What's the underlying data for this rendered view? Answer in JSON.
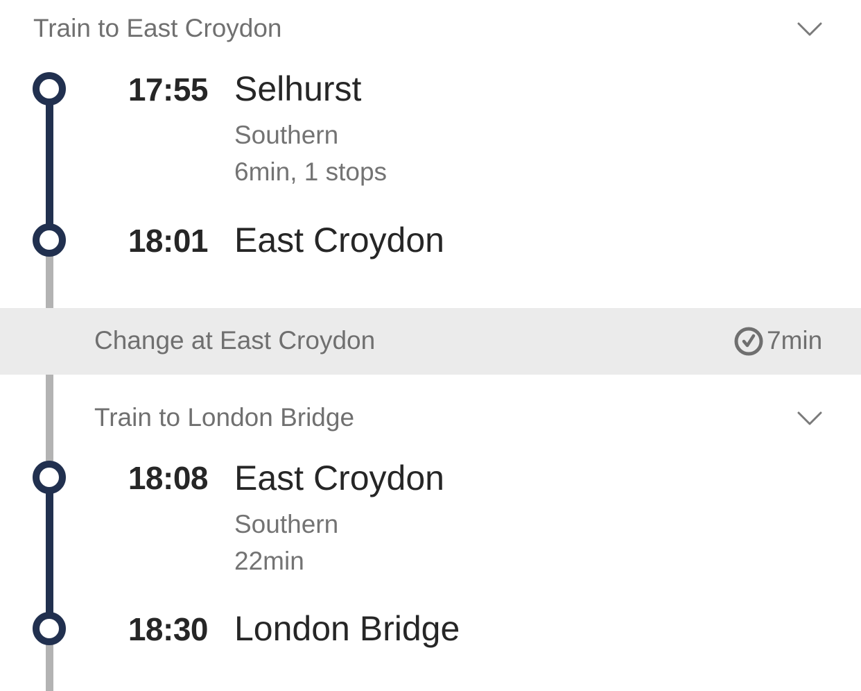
{
  "legs": [
    {
      "title": "Train to East Croydon",
      "departure": {
        "time": "17:55",
        "station": "Selhurst"
      },
      "operator": "Southern",
      "details": "6min, 1 stops",
      "arrival": {
        "time": "18:01",
        "station": "East Croydon"
      },
      "expand_icon": "chevron-down-icon"
    },
    {
      "title": "Train to London Bridge",
      "departure": {
        "time": "18:08",
        "station": "East Croydon"
      },
      "operator": "Southern",
      "details": "22min",
      "arrival": {
        "time": "18:30",
        "station": "London Bridge"
      },
      "expand_icon": "chevron-down-icon"
    }
  ],
  "change": {
    "label": "Change at East Croydon",
    "duration": "7min",
    "icon": "clock-icon"
  },
  "colors": {
    "route_line": "#21304f",
    "walk_line": "#b3b3b3",
    "change_background": "#ebebeb",
    "primary_text": "#262626",
    "secondary_text": "#737373"
  }
}
